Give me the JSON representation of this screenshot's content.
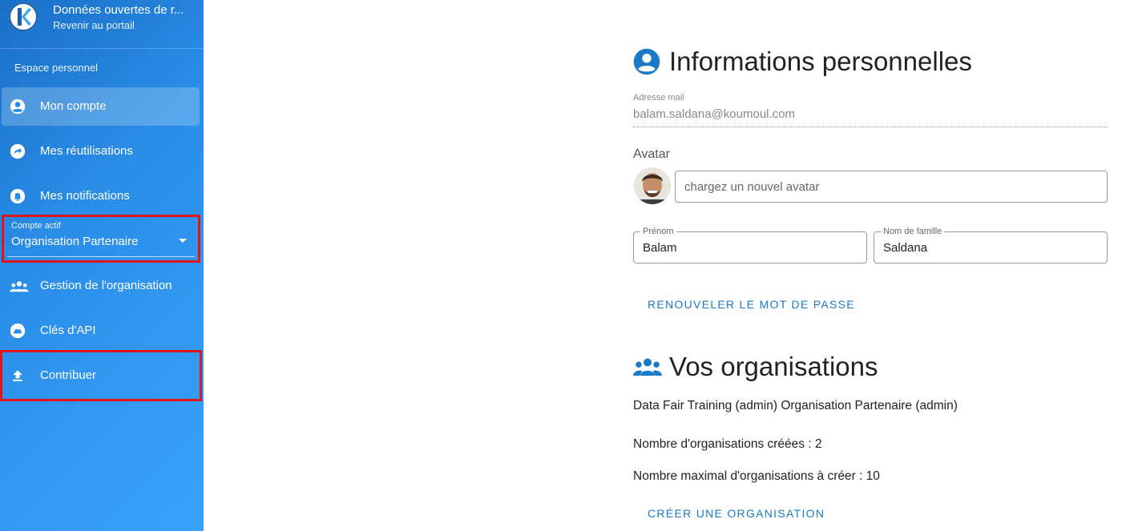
{
  "sidebar": {
    "brand_title": "Données ouvertes de r...",
    "brand_subtitle": "Revenir au portail",
    "section_title": "Espace personnel",
    "items": [
      {
        "label": "Mon compte",
        "icon": "account-circle-icon"
      },
      {
        "label": "Mes réutilisations",
        "icon": "share-arrow-icon"
      },
      {
        "label": "Mes notifications",
        "icon": "bell-icon"
      },
      {
        "label": "Gestion de l'organisation",
        "icon": "group-icon"
      },
      {
        "label": "Clés d'API",
        "icon": "cloud-icon"
      },
      {
        "label": "Contribuer",
        "icon": "upload-icon"
      }
    ],
    "account_select": {
      "label": "Compte actif",
      "value": "Organisation Partenaire"
    }
  },
  "main": {
    "personal_info": {
      "title": "Informations personnelles",
      "email_label": "Adresse mail",
      "email_value": "balam.saldana@koumoul.com",
      "avatar_label": "Avatar",
      "avatar_placeholder": "chargez un nouvel avatar",
      "firstname_label": "Prénom",
      "firstname_value": "Balam",
      "lastname_label": "Nom de famille",
      "lastname_value": "Saldana",
      "renew_password_button": "RENOUVELER LE MOT DE PASSE"
    },
    "organizations": {
      "title": "Vos organisations",
      "list_text": "Data Fair Training (admin) Organisation Partenaire (admin)",
      "created_count": "Nombre d'organisations créées : 2",
      "max_count": "Nombre maximal d'organisations à créer : 10",
      "create_button": "CRÉER UNE ORGANISATION"
    }
  },
  "colors": {
    "sidebar_start": "#1a6fc7",
    "sidebar_end": "#3aa2f8",
    "accent": "#1a7ac7",
    "highlight_box": "#e0151b"
  }
}
